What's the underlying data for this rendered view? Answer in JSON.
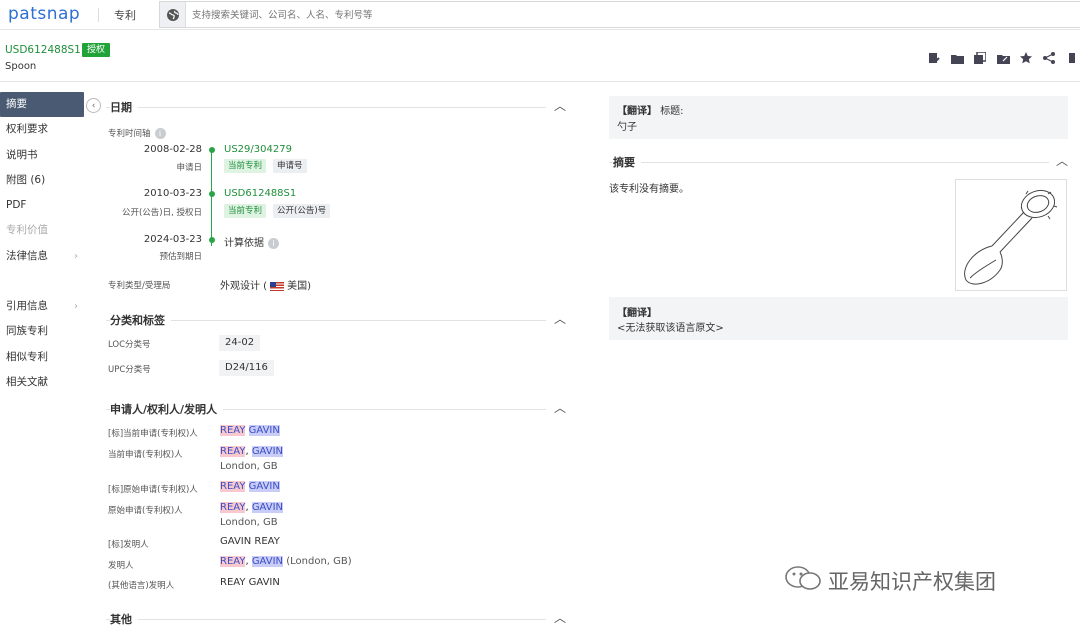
{
  "topbar": {
    "logo": "patsnap",
    "nav_patent": "专利",
    "search_placeholder": "支持搜索关键词、公司名、人名、专利号等"
  },
  "header": {
    "pub_number": "USD612488S1",
    "status_badge": "授权",
    "title": "Spoon"
  },
  "sidebar": {
    "items": [
      {
        "label": "摘要"
      },
      {
        "label": "权利要求"
      },
      {
        "label": "说明书"
      },
      {
        "label": "附图 (6)"
      },
      {
        "label": "PDF"
      },
      {
        "label": "专利价值"
      },
      {
        "label": "法律信息"
      },
      {
        "label": "引用信息"
      },
      {
        "label": "同族专利"
      },
      {
        "label": "相似专利"
      },
      {
        "label": "相关文献"
      }
    ]
  },
  "dates": {
    "section_title": "日期",
    "timeline_label": "专利时间轴",
    "events": [
      {
        "date": "2008-02-28",
        "sub": "申请日",
        "link": "US29/304279",
        "tags": [
          "当前专利",
          "申请号"
        ]
      },
      {
        "date": "2010-03-23",
        "sub": "公开(公告)日, 授权日",
        "link": "USD612488S1",
        "tags": [
          "当前专利",
          "公开(公告)号"
        ]
      },
      {
        "date": "2024-03-23",
        "sub": "预估到期日",
        "link": "计算依据",
        "tags": []
      }
    ],
    "type_label": "专利类型/受理局",
    "type_value": "外观设计 (",
    "country": "美国)"
  },
  "classification": {
    "section_title": "分类和标签",
    "loc_label": "LOC分类号",
    "loc_value": "24-02",
    "upc_label": "UPC分类号",
    "upc_value": "D24/116"
  },
  "parties": {
    "section_title": "申请人/权利人/发明人",
    "rows": [
      {
        "label": "[标]当前申请(专利权)人",
        "p1": "REAY",
        "sep": " ",
        "p2": "GAVIN",
        "extra": ""
      },
      {
        "label": "当前申请(专利权)人",
        "p1": "REAY",
        "sep": ", ",
        "p2": "GAVIN",
        "extra": "London, GB"
      },
      {
        "label": "[标]原始申请(专利权)人",
        "p1": "REAY",
        "sep": " ",
        "p2": "GAVIN",
        "extra": ""
      },
      {
        "label": "原始申请(专利权)人",
        "p1": "REAY",
        "sep": ", ",
        "p2": "GAVIN",
        "extra": "London, GB"
      },
      {
        "label": "[标]发明人",
        "plain": "GAVIN REAY"
      },
      {
        "label": "发明人",
        "p1": "REAY",
        "sep": ", ",
        "p2": "GAVIN",
        "tail": " (London, GB)"
      },
      {
        "label": "(其他语言)发明人",
        "plain": "REAY GAVIN"
      }
    ]
  },
  "other": {
    "section_title": "其他"
  },
  "right": {
    "translate_tag": "【翻译】",
    "title_label": "标题:",
    "title_value": "勺子",
    "abstract_title": "摘要",
    "abstract_text": "该专利没有摘要。",
    "translate_tag2": "【翻译】",
    "no_original": "<无法获取该语言原文>"
  },
  "watermark": "亚易知识产权集团",
  "colors": {
    "green": "#27a547",
    "blue_logo": "#2e6fd4",
    "sidebar_active": "#4a5a72"
  }
}
